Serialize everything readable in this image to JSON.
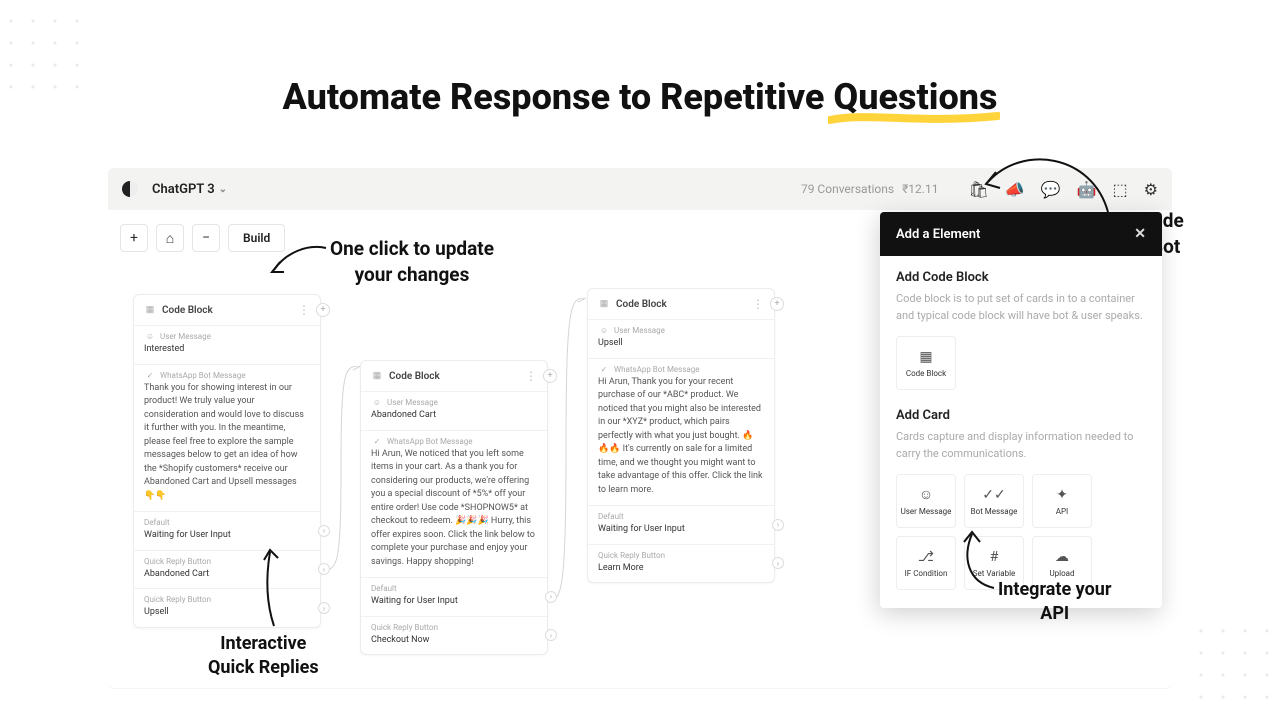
{
  "hero": {
    "title": "Automate Response to Repetitive Questions"
  },
  "topbar": {
    "space_name": "ChatGPT 3",
    "conversations": "79 Conversations",
    "balance": "₹12.11",
    "icons": {
      "bag": "bag-icon",
      "megaphone": "megaphone-icon",
      "chat": "chat-icon",
      "bot": "bot-icon",
      "cube": "cube-icon",
      "gear": "gear-icon"
    }
  },
  "toolbar": {
    "plus": "+",
    "home": "⌂",
    "minus": "−",
    "build": "Build"
  },
  "blocks": {
    "a": {
      "title": "Code Block",
      "user_msg_label": "User Message",
      "user_msg": "Interested",
      "bot_msg_label": "WhatsApp Bot Message",
      "bot_msg": "Thank you for showing interest in our product! We truly value your consideration and would love to discuss it further with you. In the meantime, please feel free to explore the sample messages below to get an idea of how the *Shopify customers* receive our Abandoned Cart and Upsell messages 👇👇",
      "default_label": "Default",
      "default_val": "Waiting for User Input",
      "qr1_label": "Quick Reply Button",
      "qr1_val": "Abandoned Cart",
      "qr2_label": "Quick Reply Button",
      "qr2_val": "Upsell"
    },
    "b": {
      "title": "Code Block",
      "user_msg_label": "User Message",
      "user_msg": "Abandoned Cart",
      "bot_msg_label": "WhatsApp Bot Message",
      "bot_msg": "Hi Arun, We noticed that you left some items in your cart. As a thank you for considering our products, we're offering you a special discount of *5%* off your entire order! Use code *SHOPNOW5* at checkout to redeem. 🎉🎉🎉 Hurry, this offer expires soon. Click the link below to complete your purchase and enjoy your savings. Happy shopping!",
      "default_label": "Default",
      "default_val": "Waiting for User Input",
      "qr1_label": "Quick Reply Button",
      "qr1_val": "Checkout Now"
    },
    "c": {
      "title": "Code Block",
      "user_msg_label": "User Message",
      "user_msg": "Upsell",
      "bot_msg_label": "WhatsApp Bot Message",
      "bot_msg": "Hi Arun, Thank you for your recent purchase of our *ABC* product. We noticed that you might also be interested in our *XYZ* product, which pairs perfectly with what you just bought. 🔥🔥🔥 It's currently on sale for a limited time, and we thought you might want to take advantage of this offer. Click the link to learn more.",
      "default_label": "Default",
      "default_val": "Waiting for User Input",
      "qr1_label": "Quick Reply Button",
      "qr1_val": "Learn More"
    }
  },
  "panel": {
    "title": "Add a Element",
    "codeblock": {
      "heading": "Add Code Block",
      "desc": "Code block is to put set of cards in to a container and typical code block will have bot & user speaks.",
      "card_label": "Code Block"
    },
    "addcard": {
      "heading": "Add Card",
      "desc": "Cards capture and display information needed to carry the communications.",
      "cards": {
        "user_message": "User Message",
        "bot_message": "Bot Message",
        "api": "API",
        "if_condition": "IF Condition",
        "set_variable": "Set Variable",
        "upload": "Upload"
      }
    }
  },
  "annotations": {
    "one_click": "One click to update\nyour changes",
    "quick_replies": "Interactive\nQuick Replies",
    "no_code": "No-Code\nChatBot",
    "api": "Integrate your\nAPI"
  }
}
